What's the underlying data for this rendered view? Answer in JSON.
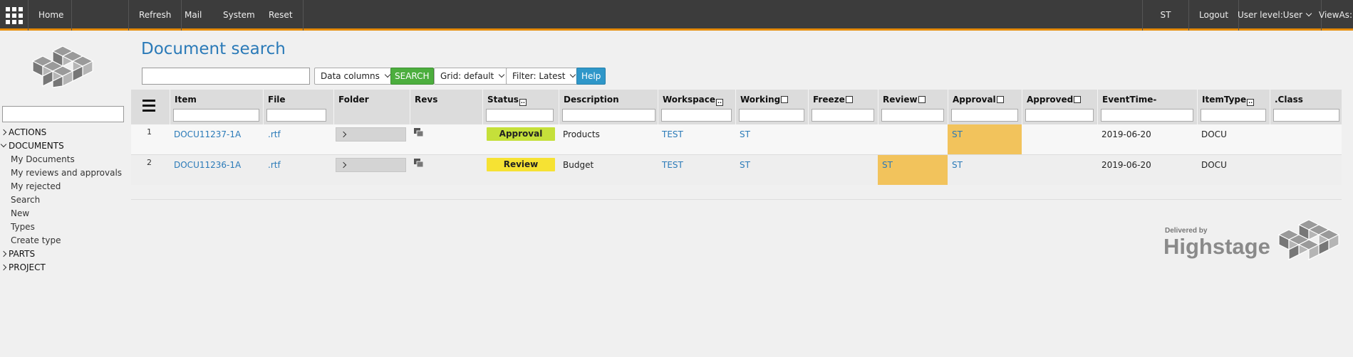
{
  "nav": {
    "home": "Home",
    "refresh": "Refresh",
    "mail": "Mail",
    "system": "System",
    "reset": "Reset",
    "user_initials": "ST",
    "logout": "Logout",
    "user_level": "User level:User",
    "view_as": "ViewAs:"
  },
  "sidebar": {
    "search_placeholder": "",
    "groups": [
      {
        "label": "ACTIONS",
        "open": false
      },
      {
        "label": "DOCUMENTS",
        "open": true,
        "items": [
          "My Documents",
          "My reviews and approvals",
          "My rejected",
          "Search",
          "New",
          "Types",
          "Create type"
        ]
      },
      {
        "label": "PARTS",
        "open": false
      },
      {
        "label": "PROJECT",
        "open": false
      }
    ]
  },
  "page": {
    "title": "Document search",
    "search_value": "",
    "data_columns": "Data columns",
    "search_button": "SEARCH",
    "grid_select": "Grid: default",
    "filter_select": "Filter: Latest",
    "help_button": "Help"
  },
  "table": {
    "columns": [
      "Item",
      "File",
      "Folder",
      "Revs",
      "Status",
      "Description",
      "Workspace",
      "Working",
      "Freeze",
      "Review",
      "Approval",
      "Approved",
      "EventTime-",
      "ItemType",
      ".Class"
    ],
    "rows": [
      {
        "num": "1",
        "item": "DOCU11237-1A",
        "file": ".rtf",
        "status": "Approval",
        "description": "Products",
        "workspace": "TEST",
        "working": "ST",
        "review": "",
        "approval": "ST",
        "event_time": "2019-06-20",
        "item_type": "DOCU"
      },
      {
        "num": "2",
        "item": "DOCU11236-1A",
        "file": ".rtf",
        "status": "Review",
        "description": "Budget",
        "workspace": "TEST",
        "working": "ST",
        "review": "ST",
        "approval": "ST",
        "event_time": "2019-06-20",
        "item_type": "DOCU"
      }
    ]
  },
  "footer": {
    "delivered_by": "Delivered by",
    "brand": "Highstage"
  },
  "colors": {
    "topbar": "#3c3c3c",
    "accent": "#e58a00",
    "link": "#2a7ab8",
    "status_approval": "#c5e03a",
    "status_review": "#f6e233",
    "highlight": "#f2c35c"
  }
}
